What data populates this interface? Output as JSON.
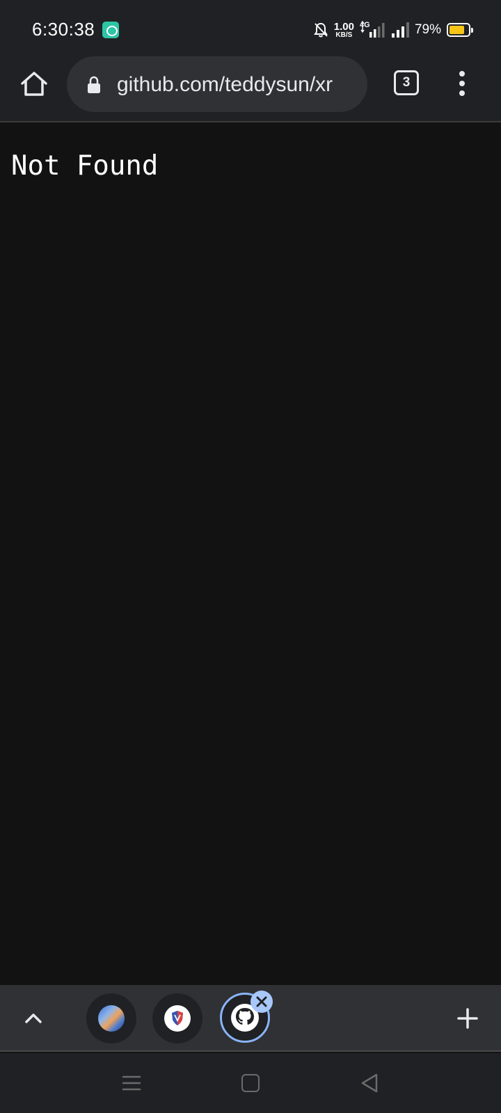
{
  "status_bar": {
    "time": "6:30:38",
    "net_speed_value": "1.00",
    "net_speed_unit": "KB/S",
    "network_type": "4G",
    "battery_percent": "79%",
    "battery_level": 0.79,
    "icons": [
      "chat-app-icon",
      "bell-off-icon",
      "signal-icon",
      "battery-icon"
    ]
  },
  "toolbar": {
    "url": "github.com/teddysun/xr",
    "tab_count": "3",
    "icons": [
      "home-icon",
      "lock-icon",
      "more-vert-icon"
    ]
  },
  "page": {
    "message": "Not Found"
  },
  "tab_strip": {
    "tabs": [
      {
        "favicon": "mosaic-favicon",
        "active": false
      },
      {
        "favicon": "shield-favicon",
        "active": false
      },
      {
        "favicon": "github-icon",
        "active": true
      }
    ],
    "icons": [
      "chevron-up-icon",
      "close-icon",
      "plus-icon"
    ]
  },
  "nav_bar": {
    "icons": [
      "recents-icon",
      "home-square-icon",
      "back-triangle-icon"
    ]
  },
  "colors": {
    "background": "#121212",
    "chrome": "#202124",
    "omnibox": "#303134",
    "accent": "#8ab4f8",
    "battery_fill": "#f5c518"
  }
}
